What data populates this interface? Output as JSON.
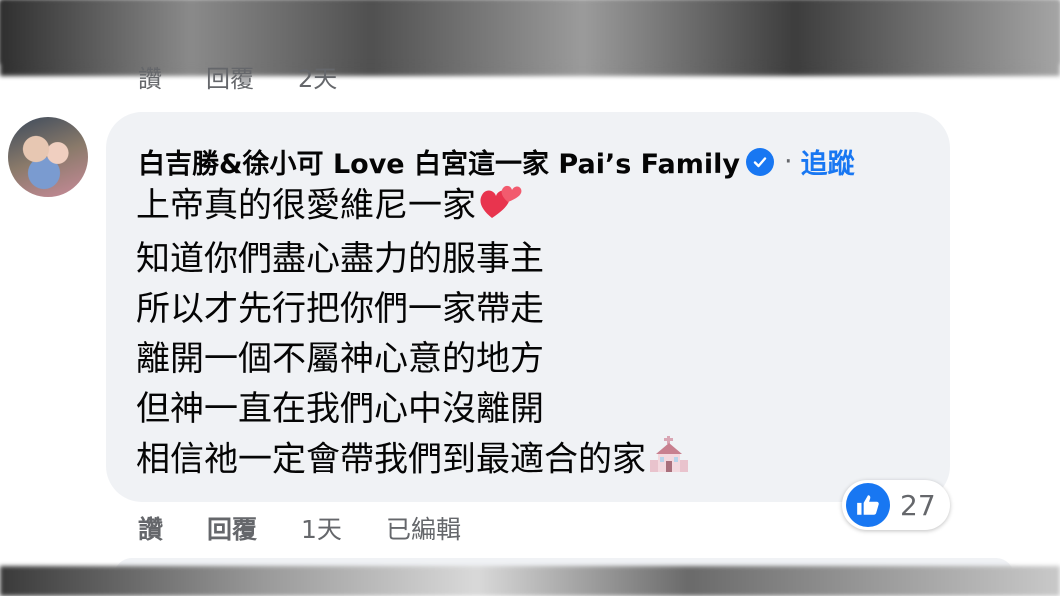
{
  "previous_comment": {
    "actions": [
      "讚",
      "回覆",
      "2天"
    ]
  },
  "comment": {
    "author": "白吉勝&徐小可 Love 白宮這一家 Pai’s Family",
    "separator": "·",
    "follow_label": "追蹤",
    "lines": [
      "上帝真的很愛維尼一家",
      "知道你們盡心盡力的服事主",
      "所以才先行把你們一家帶走",
      "離開一個不屬神心意的地方",
      "但神一直在我們心中沒離開",
      "相信祂一定會帶我們到最適合的家"
    ],
    "emojis": {
      "line1": "two-hearts-icon",
      "line6": "wedding-chapel-icon"
    },
    "actions": {
      "like": "讚",
      "reply": "回覆",
      "time": "1天",
      "edited": "已編輯"
    },
    "reaction": {
      "icon": "like-icon",
      "count": "27"
    }
  },
  "colors": {
    "bubble": "#f0f2f5",
    "accent": "#1877f2",
    "secondary_text": "#65676b",
    "primary_text": "#050505"
  }
}
